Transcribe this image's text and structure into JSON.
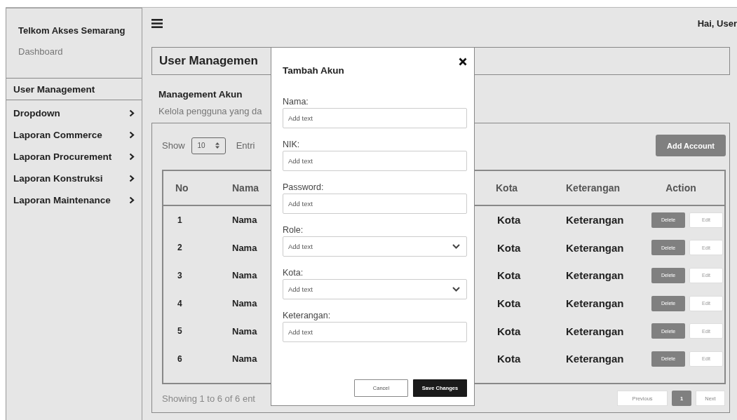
{
  "sidebar": {
    "title": "Telkom Akses Semarang",
    "subtitle": "Dashboard",
    "items": [
      {
        "label": "User Management",
        "selected": true,
        "has_submenu": false
      },
      {
        "label": "Dropdown",
        "selected": false,
        "has_submenu": true
      },
      {
        "label": "Laporan Commerce",
        "selected": false,
        "has_submenu": true
      },
      {
        "label": "Laporan Procurement",
        "selected": false,
        "has_submenu": true
      },
      {
        "label": "Laporan Konstruksi",
        "selected": false,
        "has_submenu": true
      },
      {
        "label": "Laporan Maintenance",
        "selected": false,
        "has_submenu": true
      }
    ]
  },
  "topbar": {
    "greeting": "Hai, User"
  },
  "page": {
    "title": "User Managemen",
    "section_title": "Management Akun",
    "section_subtitle": "Kelola pengguna yang da",
    "show_label": "Show",
    "page_size": "10",
    "entries_label": "Entri",
    "add_button": "Add Account",
    "table": {
      "columns": [
        "No",
        "Nama",
        "Kota",
        "Keterangan",
        "Action"
      ],
      "rows": [
        {
          "no": "1",
          "nama": "Nama",
          "kota": "Kota",
          "keterangan": "Keterangan",
          "actions": [
            "Delete",
            "Edit"
          ]
        },
        {
          "no": "2",
          "nama": "Nama",
          "kota": "Kota",
          "keterangan": "Keterangan",
          "actions": [
            "Delete",
            "Edit"
          ]
        },
        {
          "no": "3",
          "nama": "Nama",
          "kota": "Kota",
          "keterangan": "Keterangan",
          "actions": [
            "Delete",
            "Edit"
          ]
        },
        {
          "no": "4",
          "nama": "Nama",
          "kota": "Kota",
          "keterangan": "Keterangan",
          "actions": [
            "Delete",
            "Edit"
          ]
        },
        {
          "no": "5",
          "nama": "Nama",
          "kota": "Kota",
          "keterangan": "Keterangan",
          "actions": [
            "Delete",
            "Edit"
          ]
        },
        {
          "no": "6",
          "nama": "Nama",
          "kota": "Kota",
          "keterangan": "Keterangan",
          "actions": [
            "Delete",
            "Edit"
          ]
        }
      ]
    },
    "footer_info": "Showing 1 to 6 of 6 ent",
    "pagination": {
      "previous": "Previous",
      "pages": [
        {
          "label": "1",
          "selected": true
        }
      ],
      "next": "Next"
    }
  },
  "modal": {
    "title": "Tambah Akun",
    "fields": [
      {
        "label": "Nama:",
        "kind": "text",
        "placeholder": "Add text"
      },
      {
        "label": "NIK:",
        "kind": "text",
        "placeholder": "Add text"
      },
      {
        "label": "Password:",
        "kind": "text",
        "placeholder": "Add text"
      },
      {
        "label": "Role:",
        "kind": "select",
        "placeholder": "Add text"
      },
      {
        "label": "Kota:",
        "kind": "select",
        "placeholder": "Add text"
      },
      {
        "label": "Keterangan:",
        "kind": "text",
        "placeholder": "Add text"
      }
    ],
    "buttons": [
      {
        "label": "Cancel",
        "kind": "secondary"
      },
      {
        "label": "Save Changes",
        "kind": "primary"
      }
    ]
  }
}
